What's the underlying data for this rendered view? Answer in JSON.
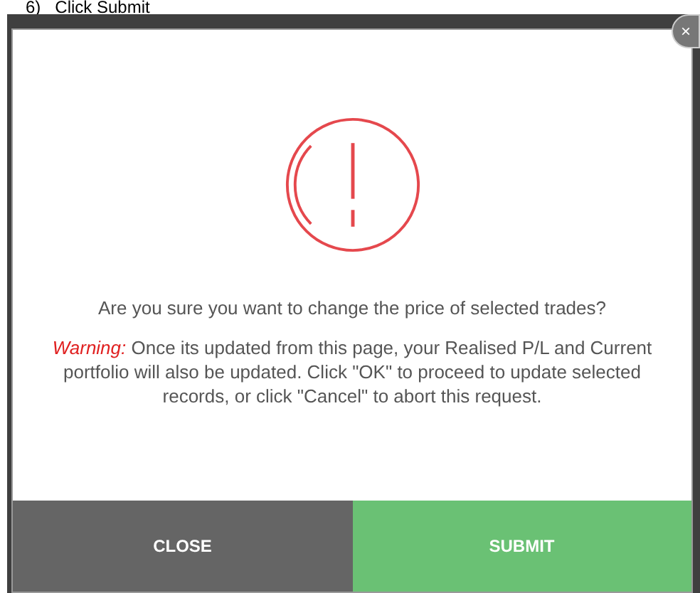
{
  "heading": "6)   Click Submit",
  "dialog": {
    "close_glyph": "×",
    "question": "Are you sure you want to change the price of selected trades?",
    "warning_label": "Warning:",
    "warning_text": "Once its updated from this page, your Realised P/L and Current portfolio will also be updated. Click \"OK\" to proceed to update selected records, or click \"Cancel\" to abort this request.",
    "buttons": [
      {
        "label": "CLOSE",
        "kind": "secondary"
      },
      {
        "label": "SUBMIT",
        "kind": "primary"
      }
    ]
  }
}
